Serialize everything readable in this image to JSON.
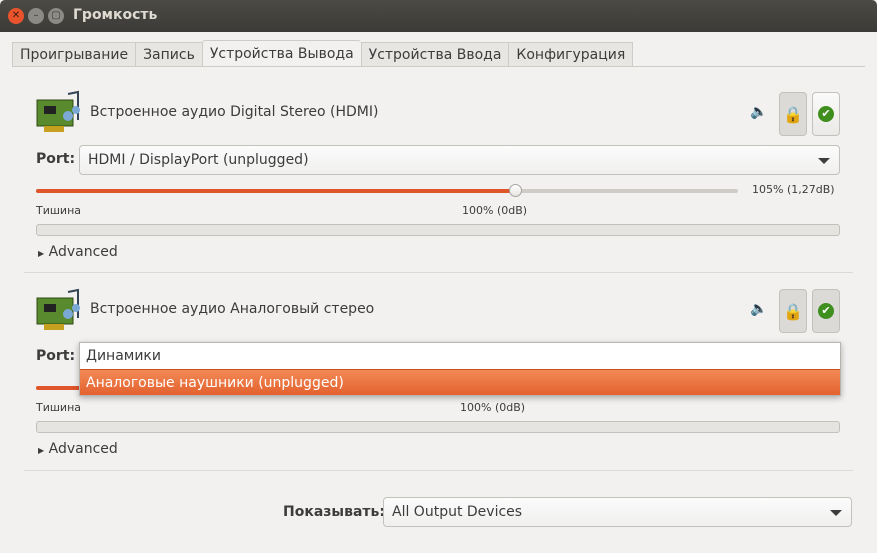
{
  "window": {
    "title": "Громкость"
  },
  "tabs": [
    {
      "label": "Проигрывание"
    },
    {
      "label": "Запись"
    },
    {
      "label": "Устройства Вывода",
      "active": true
    },
    {
      "label": "Устройства Ввода"
    },
    {
      "label": "Конфигурация"
    }
  ],
  "devices": [
    {
      "name": "Встроенное аудио Digital Stereo (HDMI)",
      "port_label": "Port:",
      "port": "HDMI / DisplayPort (unplugged)",
      "volume_percent": 105,
      "volume_text": "105% (1,27dB)",
      "min_label": "Тишина",
      "mid_label": "100% (0dB)",
      "advanced": "Advanced",
      "locked": true,
      "default": true
    },
    {
      "name": "Встроенное аудио Аналоговый стерео",
      "port_label": "Port:",
      "volume_percent": 100,
      "min_label": "Тишина",
      "mid_label": "100% (0dB)",
      "advanced": "Advanced",
      "locked": true,
      "default": true
    }
  ],
  "port_dropdown": {
    "options": [
      "Динамики",
      "Аналоговые наушники (unplugged)"
    ],
    "highlighted": 1
  },
  "footer": {
    "show_label": "Показывать:",
    "show_value": "All Output Devices"
  },
  "colors": {
    "accent": "#e0562b",
    "titlebar": "#3c3b37",
    "close": "#e9542c"
  }
}
